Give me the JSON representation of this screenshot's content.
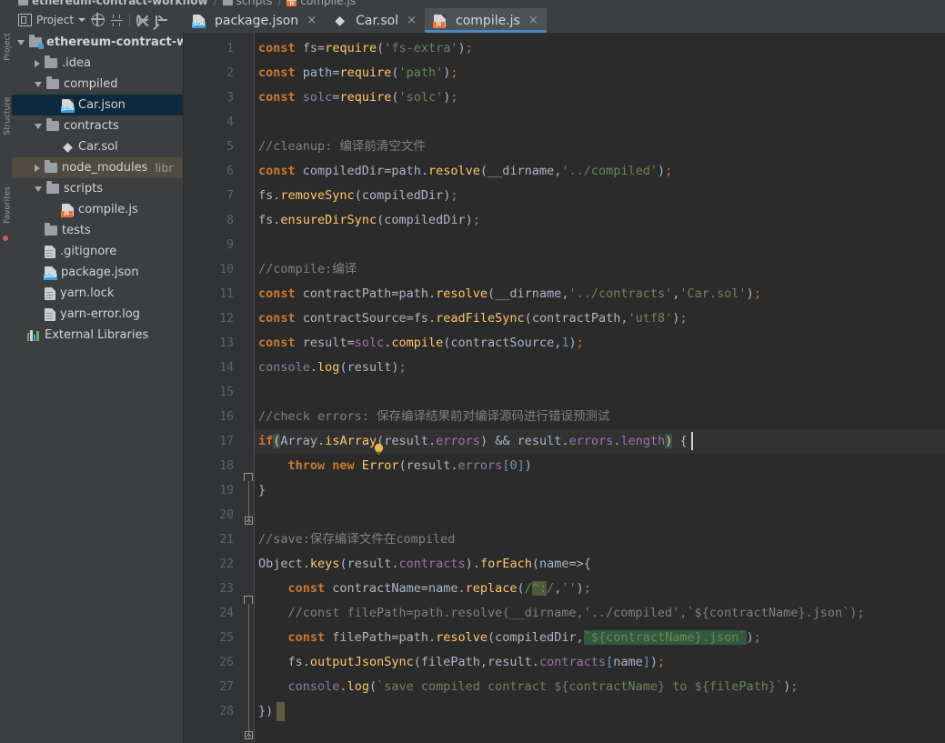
{
  "window": {
    "breadcrumb": [
      {
        "label": "ethereum-contract-workflow",
        "icon": "folder-module-icon"
      },
      {
        "label": "scripts",
        "icon": "folder-icon"
      },
      {
        "label": "compile.js",
        "icon": "js-file-icon"
      }
    ]
  },
  "tool_strip": {
    "tabs": [
      "Project",
      "Structure",
      "Favorites"
    ]
  },
  "project_panel": {
    "title": "Project",
    "toolbar": [
      {
        "name": "project-view-dropdown",
        "label": "Project"
      },
      {
        "name": "scroll-from-source-icon",
        "label": ""
      },
      {
        "name": "collapse-all-icon",
        "label": ""
      },
      {
        "name": "settings-gear-icon",
        "label": ""
      },
      {
        "name": "hide-panel-icon",
        "label": ""
      }
    ],
    "tree": [
      {
        "label": "ethereum-contract-w",
        "icon": "folder-module-icon",
        "indent": 0,
        "arrow": "down",
        "bold": true,
        "state": "normal",
        "note": ""
      },
      {
        "label": ".idea",
        "icon": "folder-icon",
        "indent": 1,
        "arrow": "right",
        "bold": false,
        "state": "normal",
        "note": ""
      },
      {
        "label": "compiled",
        "icon": "folder-icon",
        "indent": 1,
        "arrow": "down",
        "bold": false,
        "state": "normal",
        "note": ""
      },
      {
        "label": "Car.json",
        "icon": "json-file-icon",
        "indent": 2,
        "arrow": "none",
        "bold": false,
        "state": "selected",
        "note": ""
      },
      {
        "label": "contracts",
        "icon": "folder-icon",
        "indent": 1,
        "arrow": "down",
        "bold": false,
        "state": "normal",
        "note": ""
      },
      {
        "label": "Car.sol",
        "icon": "solidity-file-icon",
        "indent": 2,
        "arrow": "none",
        "bold": false,
        "state": "normal",
        "note": ""
      },
      {
        "label": "node_modules",
        "icon": "folder-icon",
        "indent": 1,
        "arrow": "right",
        "bold": false,
        "state": "library",
        "note": "libr"
      },
      {
        "label": "scripts",
        "icon": "folder-icon",
        "indent": 1,
        "arrow": "down",
        "bold": false,
        "state": "normal",
        "note": ""
      },
      {
        "label": "compile.js",
        "icon": "js-file-icon",
        "indent": 2,
        "arrow": "none",
        "bold": false,
        "state": "normal",
        "note": ""
      },
      {
        "label": "tests",
        "icon": "folder-icon",
        "indent": 1,
        "arrow": "none",
        "bold": false,
        "state": "normal",
        "note": ""
      },
      {
        "label": ".gitignore",
        "icon": "text-file-icon",
        "indent": 1,
        "arrow": "none",
        "bold": false,
        "state": "normal",
        "note": ""
      },
      {
        "label": "package.json",
        "icon": "json-file-icon",
        "indent": 1,
        "arrow": "none",
        "bold": false,
        "state": "normal",
        "note": ""
      },
      {
        "label": "yarn.lock",
        "icon": "text-file-icon",
        "indent": 1,
        "arrow": "none",
        "bold": false,
        "state": "normal",
        "note": ""
      },
      {
        "label": "yarn-error.log",
        "icon": "text-file-icon",
        "indent": 1,
        "arrow": "none",
        "bold": false,
        "state": "normal",
        "note": ""
      },
      {
        "label": "External Libraries",
        "icon": "libraries-icon",
        "indent": 0,
        "arrow": "none",
        "bold": false,
        "state": "normal",
        "note": ""
      }
    ]
  },
  "tabs": [
    {
      "label": "package.json",
      "icon": "json-file-icon",
      "active": false,
      "close": "×"
    },
    {
      "label": "Car.sol",
      "icon": "solidity-file-icon",
      "active": false,
      "close": "×"
    },
    {
      "label": "compile.js",
      "icon": "js-file-icon",
      "active": true,
      "close": "×"
    }
  ],
  "editor": {
    "active_file": "compile.js",
    "caret_line": 17,
    "line_numbers": [
      1,
      2,
      3,
      4,
      5,
      6,
      7,
      8,
      9,
      10,
      11,
      12,
      13,
      14,
      15,
      16,
      17,
      18,
      19,
      20,
      21,
      22,
      23,
      24,
      25,
      26,
      27,
      28
    ],
    "lines": [
      "const fs=require('fs-extra');",
      "const path=require('path');",
      "const solc=require('solc');",
      "",
      "//cleanup: 编译前清空文件",
      "const compiledDir=path.resolve(__dirname,'../compiled');",
      "fs.removeSync(compiledDir);",
      "fs.ensureDirSync(compiledDir);",
      "",
      "//compile:编译",
      "const contractPath=path.resolve(__dirname,'../contracts','Car.sol');",
      "const contractSource=fs.readFileSync(contractPath,'utf8');",
      "const result=solc.compile(contractSource,1);",
      "console.log(result);",
      "",
      "//check errors: 保存编译结果前对编译源码进行错误预测试",
      "if(Array.isArray(result.errors) && result.errors.length) {",
      "    throw new Error(result.errors[0])",
      "}",
      "",
      "//save:保存编译文件在compiled",
      "Object.keys(result.contracts).forEach(name=>{",
      "    const contractName=name.replace(/^:/,'');",
      "    //const filePath=path.resolve(__dirname,'../compiled',`${contractName}.json`);",
      "    const filePath=path.resolve(compiledDir,`${contractName}.json`);",
      "    fs.outputJsonSync(filePath,result.contracts[name]);",
      "    console.log(`save compiled contract ${contractName} to ${filePath}`);",
      "})"
    ]
  },
  "colors": {
    "editor_bg": "#2b2b2b",
    "panel_bg": "#3c3f41",
    "gutter_bg": "#313335",
    "keyword": "#cc7832",
    "string": "#6a8759",
    "function": "#ffc66d",
    "identifier": "#a9b7c6",
    "field": "#9876aa",
    "number": "#6897bb",
    "comment": "#808080",
    "selection": "#0d293e",
    "library_row": "#4f4b41",
    "active_tab_underline": "#4a88c7",
    "caret_row": "#323232"
  }
}
